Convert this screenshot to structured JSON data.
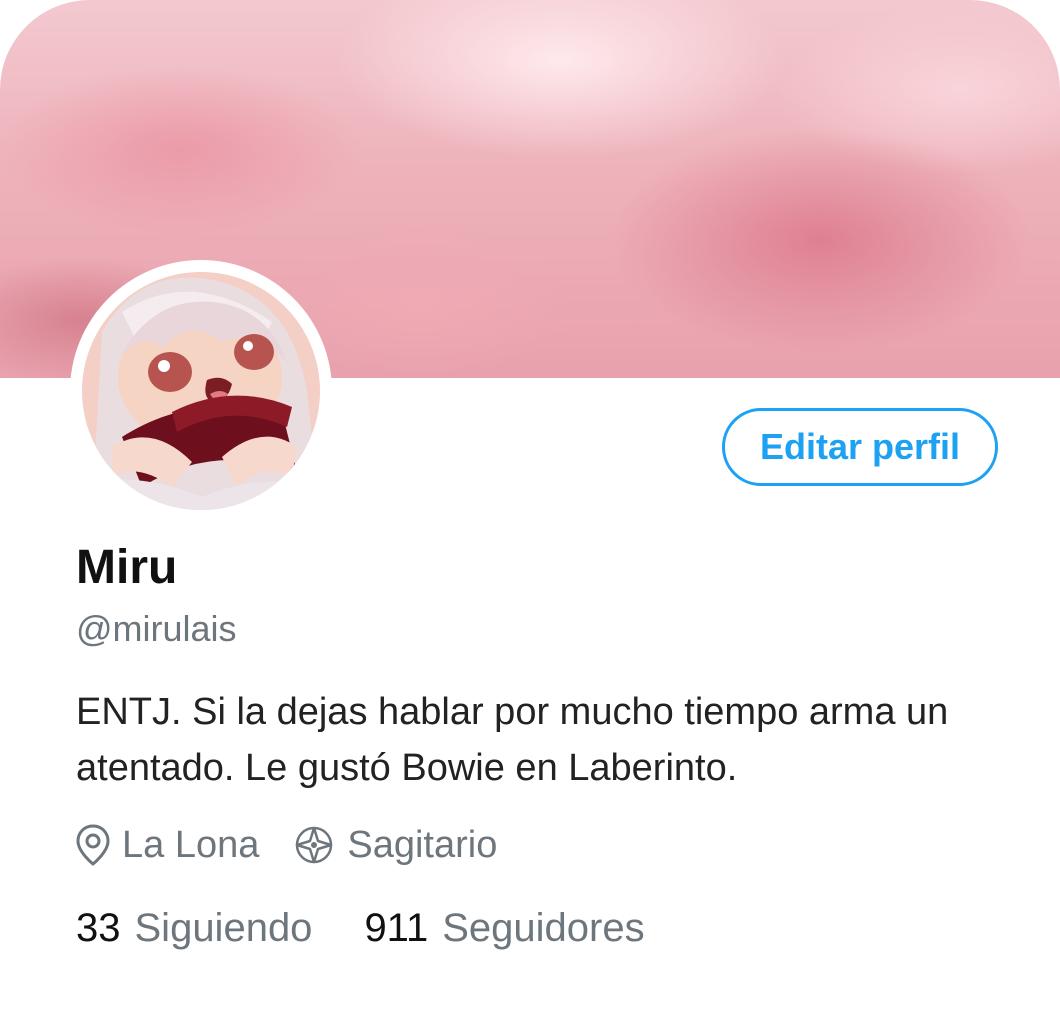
{
  "profile": {
    "name": "Miru",
    "handle": "@mirulais",
    "bio": "ENTJ. Si la dejas hablar por mucho tiempo arma un atentado. Le gustó Bowie en Laberinto.",
    "location": "La Lona",
    "zodiac": "Sagitario"
  },
  "actions": {
    "edit_label": "Editar perfil"
  },
  "stats": {
    "following_count": "33",
    "following_label": "Siguiendo",
    "followers_count": "911",
    "followers_label": "Seguidores"
  },
  "icons": {
    "location": "map-pin-icon",
    "zodiac": "compass-star-icon"
  },
  "colors": {
    "accent": "#1da1f2",
    "text": "#111111",
    "muted": "#6e767d",
    "banner": "#eeb2bb"
  }
}
